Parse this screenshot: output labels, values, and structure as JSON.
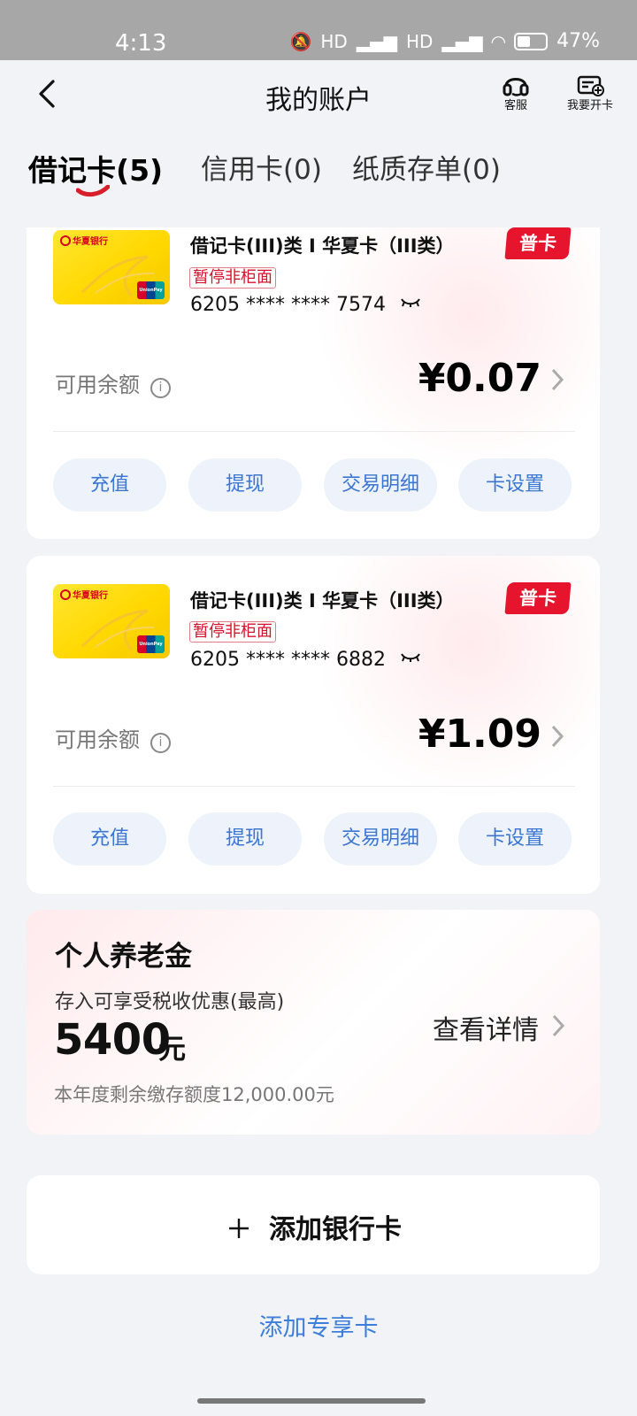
{
  "status": {
    "time": "4:13",
    "network": "HD",
    "battery": "47%"
  },
  "header": {
    "title": "我的账户",
    "service_label": "客服",
    "open_card_label": "我要开卡"
  },
  "tabs": [
    {
      "label": "借记卡(5)",
      "active": true
    },
    {
      "label": "信用卡(0)",
      "active": false
    },
    {
      "label": "纸质存单(0)",
      "active": false
    }
  ],
  "accounts": [
    {
      "card_bank": "华夏银行",
      "card_brand": "UnionPay",
      "title": "借记卡(III)类 I 华夏卡（III类）",
      "tag": "暂停非柜面",
      "number": "6205 **** **** 7574",
      "badge": "普卡",
      "balance_label": "可用余额",
      "balance": "¥0.07",
      "actions": [
        "充值",
        "提现",
        "交易明细",
        "卡设置"
      ]
    },
    {
      "card_bank": "华夏银行",
      "card_brand": "UnionPay",
      "title": "借记卡(III)类 I 华夏卡（III类）",
      "tag": "暂停非柜面",
      "number": "6205 **** **** 6882",
      "badge": "普卡",
      "balance_label": "可用余额",
      "balance": "¥1.09",
      "actions": [
        "充值",
        "提现",
        "交易明细",
        "卡设置"
      ]
    }
  ],
  "pension": {
    "title": "个人养老金",
    "description": "存入可享受税收优惠(最高)",
    "amount": "5400",
    "unit": "元",
    "remaining_note": "本年度剩余缴存额度12,000.00元",
    "link_label": "查看详情"
  },
  "add_card": {
    "label": "添加银行卡"
  },
  "exclusive_card": {
    "label": "添加专享卡"
  },
  "colors": {
    "accent_blue": "#3a76d4",
    "badge_red": "#e6142c",
    "card_yellow": "#ffd800"
  },
  "icons": {
    "back": "chevron-left-icon",
    "service": "headset-icon",
    "open_card": "card-plus-icon",
    "info": "info-icon",
    "masked": "eye-closed-icon",
    "balance_more": "chevron-right-icon",
    "add": "plus-icon"
  }
}
